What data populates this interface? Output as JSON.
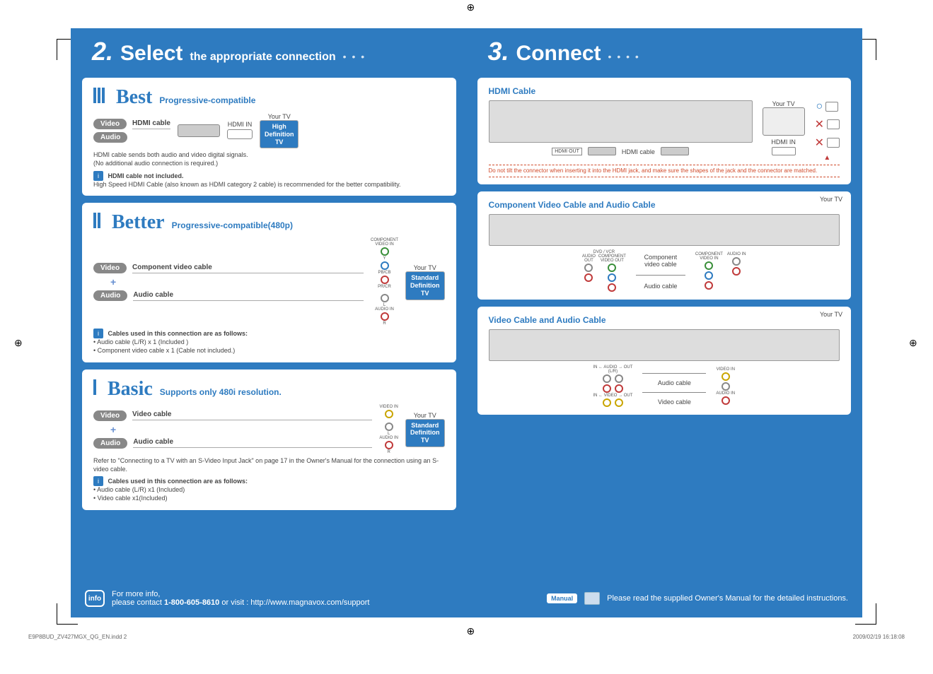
{
  "header": {
    "step2": {
      "num": "2.",
      "title": "Select",
      "subtitle": "the appropriate connection"
    },
    "step3": {
      "num": "3.",
      "title": "Connect"
    }
  },
  "best": {
    "heading": "Best",
    "sub": "Progressive-compatible",
    "yourtv": "Your TV",
    "videoPill": "Video",
    "audioPill": "Audio",
    "cableLabel": "HDMI cable",
    "hdmiIn": "HDMI IN",
    "tvBox": "High\nDefinition\nTV",
    "desc1": "HDMI cable sends both audio and video digital signals.",
    "desc2": "(No additional audio connection is required.)",
    "noteTitle": "HDMI cable not included.",
    "noteBody": "High Speed HDMI Cable (also known as HDMI category 2 cable) is recommended for the better compatibility."
  },
  "better": {
    "heading": "Better",
    "sub": "Progressive-compatible(480p)",
    "videoPill": "Video",
    "audioPill": "Audio",
    "compLabel": "Component video cable",
    "audioLabel": "Audio cable",
    "yourtv": "Your TV",
    "tvBox": "Standard\nDefinition\nTV",
    "noteTitle": "Cables used in this connection are as follows:",
    "noteLine1": "• Audio cable (L/R) x 1 (Included )",
    "noteLine2": "• Component video cable x 1 (Cable not included.)",
    "compIn": "COMPONENT\nVIDEO IN",
    "y": "Y",
    "pb": "PB/CB",
    "pr": "PR/CR",
    "l": "L",
    "r": "R",
    "audioIn": "AUDIO IN"
  },
  "basic": {
    "heading": "Basic",
    "sub": "Supports only 480i resolution.",
    "videoPill": "Video",
    "audioPill": "Audio",
    "videoLabel": "Video cable",
    "audioLabel": "Audio cable",
    "yourtv": "Your TV",
    "tvBox": "Standard\nDefinition\nTV",
    "refer": "Refer to \"Connecting to a TV with an S-Video Input Jack\" on page 17 in the Owner's Manual for the connection using an S-video cable.",
    "noteTitle": "Cables used in this connection are as follows:",
    "noteLine1": "• Audio cable (L/R) x1 (Included)",
    "noteLine2": "• Video cable x1(Included)",
    "videoIn": "VIDEO IN",
    "l": "L",
    "r": "R",
    "audioIn": "AUDIO IN"
  },
  "connect": {
    "hdmi": {
      "title": "HDMI Cable",
      "yourtv": "Your TV",
      "hdmiOut": "HDMI OUT",
      "hdmiCable": "HDMI cable",
      "hdmiIn": "HDMI IN",
      "caution": "Do not tilt the connector when inserting it into the HDMI jack, and make sure the shapes of the jack and the connector are matched."
    },
    "component": {
      "title": "Component Video Cable and Audio Cable",
      "yourtv": "Your TV",
      "dvdVcr": "DVD / VCR",
      "compOut": "COMPONENT\nVIDEO OUT",
      "audioOut": "AUDIO\nOUT",
      "compCable": "Component\nvideo cable",
      "audioCable": "Audio cable",
      "compIn": "COMPONENT\nVIDEO IN",
      "audioIn": "AUDIO IN"
    },
    "video": {
      "title": "Video Cable and Audio Cable",
      "yourtv": "Your TV",
      "audioInOut": "IN ← AUDIO → OUT",
      "videoInOut": "IN ← VIDEO → OUT",
      "lr": "(L/R)",
      "audioCable": "Audio cable",
      "videoCable": "Video cable",
      "videoIn": "VIDEO IN",
      "audioIn": "AUDIO IN"
    }
  },
  "footer": {
    "infoLabel": "info",
    "moreInfo": "For more info,",
    "contact": "please contact ",
    "phone": "1-800-605-8610",
    "orVisit": " or visit : http://www.magnavox.com/support",
    "manualTag": "Manual",
    "manualText": "Please read the supplied Owner's Manual for the detailed instructions."
  },
  "meta": {
    "file": "E9P8BUD_ZV427MGX_QG_EN.indd   2",
    "date": "2009/02/19   16:18:08"
  }
}
